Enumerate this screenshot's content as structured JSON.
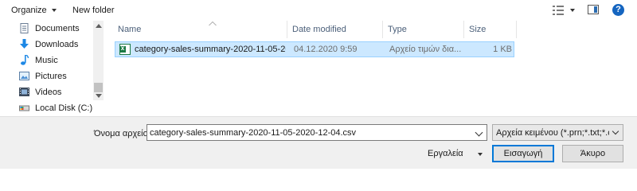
{
  "toolbar": {
    "organize_label": "Organize",
    "new_folder_label": "New folder",
    "view_icon": "details-view-icon",
    "pane_icon": "preview-pane-icon",
    "help_icon": "help-icon",
    "help_glyph": "?"
  },
  "nav": {
    "items": [
      {
        "label": "Documents",
        "icon": "documents-icon"
      },
      {
        "label": "Downloads",
        "icon": "downloads-icon"
      },
      {
        "label": "Music",
        "icon": "music-icon"
      },
      {
        "label": "Pictures",
        "icon": "pictures-icon"
      },
      {
        "label": "Videos",
        "icon": "videos-icon"
      },
      {
        "label": "Local Disk (C:)",
        "icon": "local-disk-icon"
      }
    ]
  },
  "list": {
    "columns": {
      "name": "Name",
      "date": "Date modified",
      "type": "Type",
      "size": "Size"
    },
    "rows": [
      {
        "name": "category-sales-summary-2020-11-05-202...",
        "date": "04.12.2020 9:59",
        "type": "Αρχείο τιμών δια...",
        "size": "1 KB",
        "selected": true
      }
    ]
  },
  "bottom": {
    "filename_label": "Όνομα αρχείου:",
    "filename_value": "category-sales-summary-2020-11-05-2020-12-04.csv",
    "filetype_value": "Αρχεία κειμένου (*.prn;*.txt;*.csv)",
    "tools_label": "Εργαλεία",
    "open_label": "Εισαγωγή",
    "cancel_label": "Άκυρο"
  },
  "colors": {
    "selection_bg": "#cce8ff",
    "selection_border": "#99d1ff",
    "accent": "#0078d7",
    "header_text": "#4c607a"
  }
}
